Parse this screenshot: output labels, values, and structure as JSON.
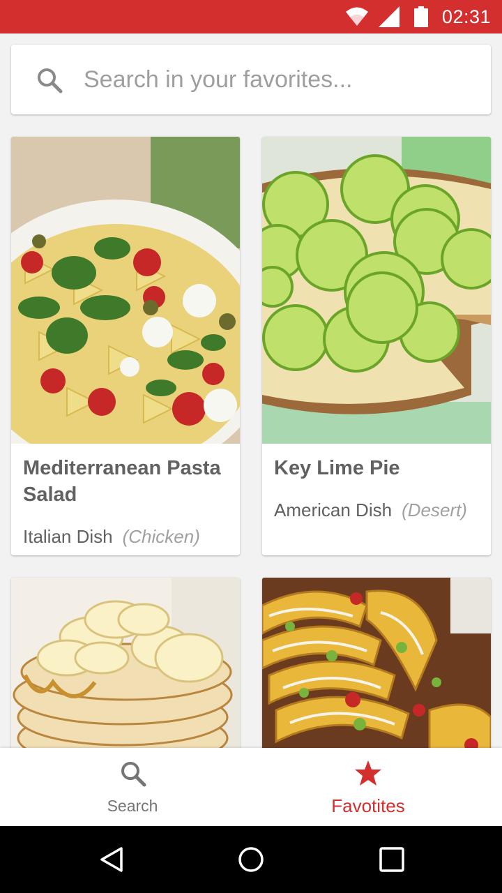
{
  "status_bar": {
    "time": "02:31",
    "color": "#d32f2f",
    "icons": [
      "wifi-icon",
      "signal-icon",
      "battery-icon"
    ]
  },
  "search": {
    "placeholder": "Search in your favorites...",
    "value": "",
    "icon": "search-icon"
  },
  "cards": [
    {
      "title": "Mediterranean Pasta Salad",
      "cuisine": "Italian Dish",
      "category": "(Chicken)",
      "image": "pasta-salad-photo"
    },
    {
      "title": "Key Lime Pie",
      "cuisine": "American Dish",
      "category": "(Desert)",
      "image": "key-lime-pie-photo"
    },
    {
      "title": "",
      "cuisine": "",
      "category": "",
      "image": "banana-pancakes-photo"
    },
    {
      "title": "",
      "cuisine": "",
      "category": "",
      "image": "tacos-photo"
    }
  ],
  "bottom_nav": {
    "items": [
      {
        "label": "Search",
        "icon": "search-icon",
        "active": false
      },
      {
        "label": "Favotites",
        "icon": "star-icon",
        "active": true
      }
    ],
    "active_color": "#d32f2f",
    "inactive_color": "#757575"
  },
  "system_nav": {
    "buttons": [
      "back-icon",
      "home-icon",
      "recents-icon"
    ]
  }
}
